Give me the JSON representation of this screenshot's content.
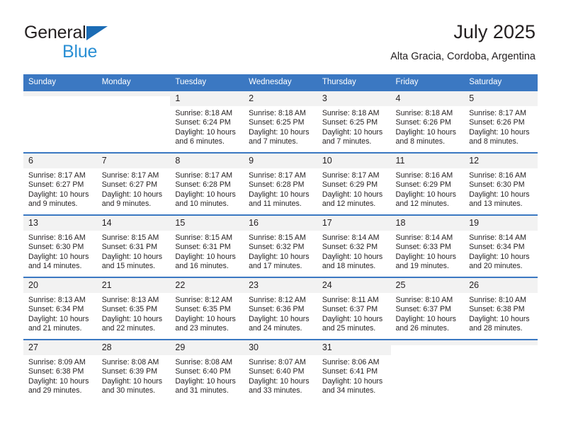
{
  "brand": {
    "line1": "General",
    "line2": "Blue",
    "accent_color": "#1b6cb5",
    "blue_text_color": "#2a8fd4"
  },
  "header": {
    "title": "July 2025",
    "subtitle": "Alta Gracia, Cordoba, Argentina",
    "header_bg_color": "#3b78c2",
    "header_text_color": "#ffffff",
    "daynum_bg_color": "#f2f2f2"
  },
  "calendar": {
    "weekday_headers": [
      "Sunday",
      "Monday",
      "Tuesday",
      "Wednesday",
      "Thursday",
      "Friday",
      "Saturday"
    ],
    "weeks": [
      [
        {
          "day": "",
          "sunrise": "",
          "sunset": "",
          "daylight_line1": "",
          "daylight_line2": ""
        },
        {
          "day": "",
          "sunrise": "",
          "sunset": "",
          "daylight_line1": "",
          "daylight_line2": ""
        },
        {
          "day": "1",
          "sunrise": "Sunrise: 8:18 AM",
          "sunset": "Sunset: 6:24 PM",
          "daylight_line1": "Daylight: 10 hours",
          "daylight_line2": "and 6 minutes."
        },
        {
          "day": "2",
          "sunrise": "Sunrise: 8:18 AM",
          "sunset": "Sunset: 6:25 PM",
          "daylight_line1": "Daylight: 10 hours",
          "daylight_line2": "and 7 minutes."
        },
        {
          "day": "3",
          "sunrise": "Sunrise: 8:18 AM",
          "sunset": "Sunset: 6:25 PM",
          "daylight_line1": "Daylight: 10 hours",
          "daylight_line2": "and 7 minutes."
        },
        {
          "day": "4",
          "sunrise": "Sunrise: 8:18 AM",
          "sunset": "Sunset: 6:26 PM",
          "daylight_line1": "Daylight: 10 hours",
          "daylight_line2": "and 8 minutes."
        },
        {
          "day": "5",
          "sunrise": "Sunrise: 8:17 AM",
          "sunset": "Sunset: 6:26 PM",
          "daylight_line1": "Daylight: 10 hours",
          "daylight_line2": "and 8 minutes."
        }
      ],
      [
        {
          "day": "6",
          "sunrise": "Sunrise: 8:17 AM",
          "sunset": "Sunset: 6:27 PM",
          "daylight_line1": "Daylight: 10 hours",
          "daylight_line2": "and 9 minutes."
        },
        {
          "day": "7",
          "sunrise": "Sunrise: 8:17 AM",
          "sunset": "Sunset: 6:27 PM",
          "daylight_line1": "Daylight: 10 hours",
          "daylight_line2": "and 9 minutes."
        },
        {
          "day": "8",
          "sunrise": "Sunrise: 8:17 AM",
          "sunset": "Sunset: 6:28 PM",
          "daylight_line1": "Daylight: 10 hours",
          "daylight_line2": "and 10 minutes."
        },
        {
          "day": "9",
          "sunrise": "Sunrise: 8:17 AM",
          "sunset": "Sunset: 6:28 PM",
          "daylight_line1": "Daylight: 10 hours",
          "daylight_line2": "and 11 minutes."
        },
        {
          "day": "10",
          "sunrise": "Sunrise: 8:17 AM",
          "sunset": "Sunset: 6:29 PM",
          "daylight_line1": "Daylight: 10 hours",
          "daylight_line2": "and 12 minutes."
        },
        {
          "day": "11",
          "sunrise": "Sunrise: 8:16 AM",
          "sunset": "Sunset: 6:29 PM",
          "daylight_line1": "Daylight: 10 hours",
          "daylight_line2": "and 12 minutes."
        },
        {
          "day": "12",
          "sunrise": "Sunrise: 8:16 AM",
          "sunset": "Sunset: 6:30 PM",
          "daylight_line1": "Daylight: 10 hours",
          "daylight_line2": "and 13 minutes."
        }
      ],
      [
        {
          "day": "13",
          "sunrise": "Sunrise: 8:16 AM",
          "sunset": "Sunset: 6:30 PM",
          "daylight_line1": "Daylight: 10 hours",
          "daylight_line2": "and 14 minutes."
        },
        {
          "day": "14",
          "sunrise": "Sunrise: 8:15 AM",
          "sunset": "Sunset: 6:31 PM",
          "daylight_line1": "Daylight: 10 hours",
          "daylight_line2": "and 15 minutes."
        },
        {
          "day": "15",
          "sunrise": "Sunrise: 8:15 AM",
          "sunset": "Sunset: 6:31 PM",
          "daylight_line1": "Daylight: 10 hours",
          "daylight_line2": "and 16 minutes."
        },
        {
          "day": "16",
          "sunrise": "Sunrise: 8:15 AM",
          "sunset": "Sunset: 6:32 PM",
          "daylight_line1": "Daylight: 10 hours",
          "daylight_line2": "and 17 minutes."
        },
        {
          "day": "17",
          "sunrise": "Sunrise: 8:14 AM",
          "sunset": "Sunset: 6:32 PM",
          "daylight_line1": "Daylight: 10 hours",
          "daylight_line2": "and 18 minutes."
        },
        {
          "day": "18",
          "sunrise": "Sunrise: 8:14 AM",
          "sunset": "Sunset: 6:33 PM",
          "daylight_line1": "Daylight: 10 hours",
          "daylight_line2": "and 19 minutes."
        },
        {
          "day": "19",
          "sunrise": "Sunrise: 8:14 AM",
          "sunset": "Sunset: 6:34 PM",
          "daylight_line1": "Daylight: 10 hours",
          "daylight_line2": "and 20 minutes."
        }
      ],
      [
        {
          "day": "20",
          "sunrise": "Sunrise: 8:13 AM",
          "sunset": "Sunset: 6:34 PM",
          "daylight_line1": "Daylight: 10 hours",
          "daylight_line2": "and 21 minutes."
        },
        {
          "day": "21",
          "sunrise": "Sunrise: 8:13 AM",
          "sunset": "Sunset: 6:35 PM",
          "daylight_line1": "Daylight: 10 hours",
          "daylight_line2": "and 22 minutes."
        },
        {
          "day": "22",
          "sunrise": "Sunrise: 8:12 AM",
          "sunset": "Sunset: 6:35 PM",
          "daylight_line1": "Daylight: 10 hours",
          "daylight_line2": "and 23 minutes."
        },
        {
          "day": "23",
          "sunrise": "Sunrise: 8:12 AM",
          "sunset": "Sunset: 6:36 PM",
          "daylight_line1": "Daylight: 10 hours",
          "daylight_line2": "and 24 minutes."
        },
        {
          "day": "24",
          "sunrise": "Sunrise: 8:11 AM",
          "sunset": "Sunset: 6:37 PM",
          "daylight_line1": "Daylight: 10 hours",
          "daylight_line2": "and 25 minutes."
        },
        {
          "day": "25",
          "sunrise": "Sunrise: 8:10 AM",
          "sunset": "Sunset: 6:37 PM",
          "daylight_line1": "Daylight: 10 hours",
          "daylight_line2": "and 26 minutes."
        },
        {
          "day": "26",
          "sunrise": "Sunrise: 8:10 AM",
          "sunset": "Sunset: 6:38 PM",
          "daylight_line1": "Daylight: 10 hours",
          "daylight_line2": "and 28 minutes."
        }
      ],
      [
        {
          "day": "27",
          "sunrise": "Sunrise: 8:09 AM",
          "sunset": "Sunset: 6:38 PM",
          "daylight_line1": "Daylight: 10 hours",
          "daylight_line2": "and 29 minutes."
        },
        {
          "day": "28",
          "sunrise": "Sunrise: 8:08 AM",
          "sunset": "Sunset: 6:39 PM",
          "daylight_line1": "Daylight: 10 hours",
          "daylight_line2": "and 30 minutes."
        },
        {
          "day": "29",
          "sunrise": "Sunrise: 8:08 AM",
          "sunset": "Sunset: 6:40 PM",
          "daylight_line1": "Daylight: 10 hours",
          "daylight_line2": "and 31 minutes."
        },
        {
          "day": "30",
          "sunrise": "Sunrise: 8:07 AM",
          "sunset": "Sunset: 6:40 PM",
          "daylight_line1": "Daylight: 10 hours",
          "daylight_line2": "and 33 minutes."
        },
        {
          "day": "31",
          "sunrise": "Sunrise: 8:06 AM",
          "sunset": "Sunset: 6:41 PM",
          "daylight_line1": "Daylight: 10 hours",
          "daylight_line2": "and 34 minutes."
        },
        {
          "day": "",
          "sunrise": "",
          "sunset": "",
          "daylight_line1": "",
          "daylight_line2": ""
        },
        {
          "day": "",
          "sunrise": "",
          "sunset": "",
          "daylight_line1": "",
          "daylight_line2": ""
        }
      ]
    ]
  }
}
